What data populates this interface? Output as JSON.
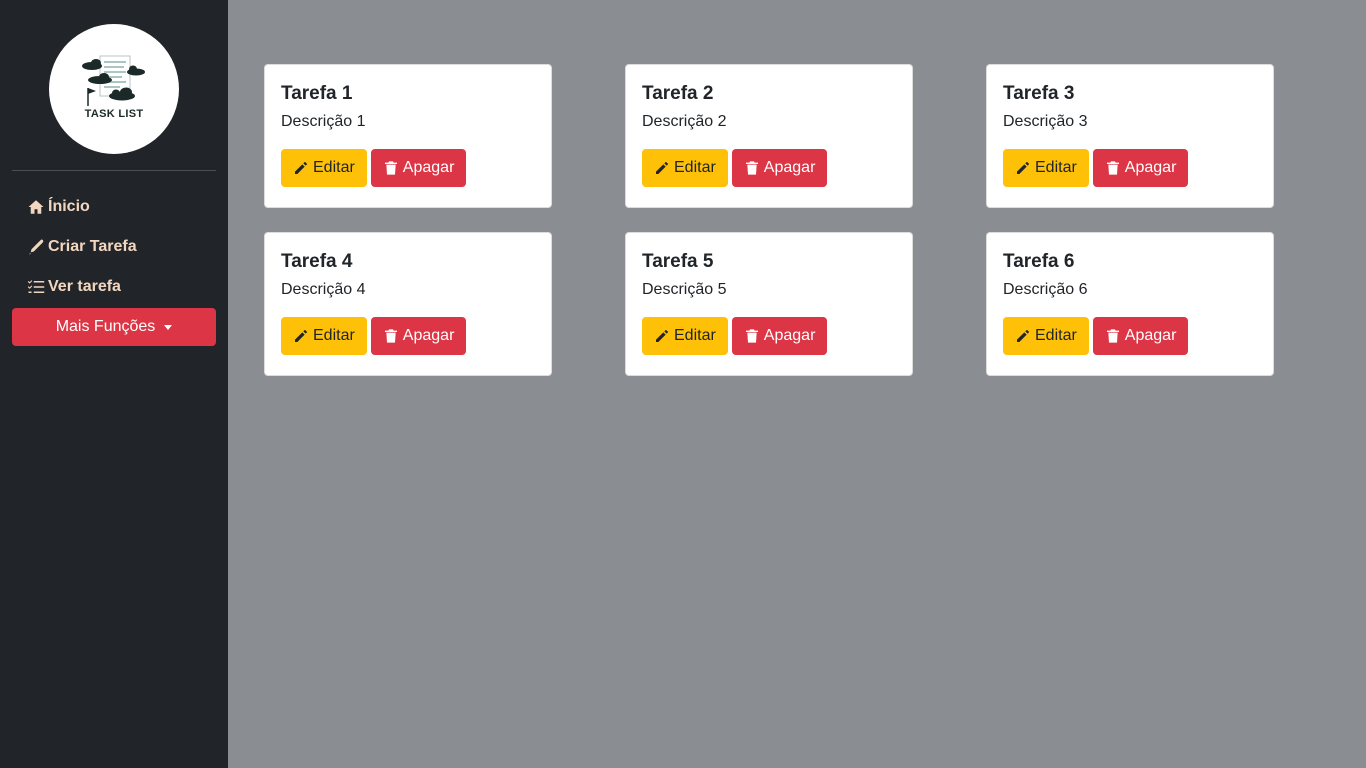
{
  "brand": {
    "logo_text": "TASK LIST"
  },
  "sidebar": {
    "items": [
      {
        "label": "Ínicio",
        "icon": "home-icon"
      },
      {
        "label": "Criar Tarefa",
        "icon": "pen-icon"
      },
      {
        "label": "Ver tarefa",
        "icon": "list-check-icon"
      }
    ],
    "dropdown_label": "Mais Funções"
  },
  "colors": {
    "sidebar_bg": "#212529",
    "nav_text": "#f1d7c0",
    "danger": "#dc3545",
    "warning": "#ffc107",
    "main_bg": "#8a8d92"
  },
  "tasks": [
    {
      "title": "Tarefa 1",
      "description": "Descrição 1",
      "edit_label": "Editar",
      "delete_label": "Apagar"
    },
    {
      "title": "Tarefa 2",
      "description": "Descrição 2",
      "edit_label": "Editar",
      "delete_label": "Apagar"
    },
    {
      "title": "Tarefa 3",
      "description": "Descrição 3",
      "edit_label": "Editar",
      "delete_label": "Apagar"
    },
    {
      "title": "Tarefa 4",
      "description": "Descrição 4",
      "edit_label": "Editar",
      "delete_label": "Apagar"
    },
    {
      "title": "Tarefa 5",
      "description": "Descrição 5",
      "edit_label": "Editar",
      "delete_label": "Apagar"
    },
    {
      "title": "Tarefa 6",
      "description": "Descrição 6",
      "edit_label": "Editar",
      "delete_label": "Apagar"
    }
  ]
}
